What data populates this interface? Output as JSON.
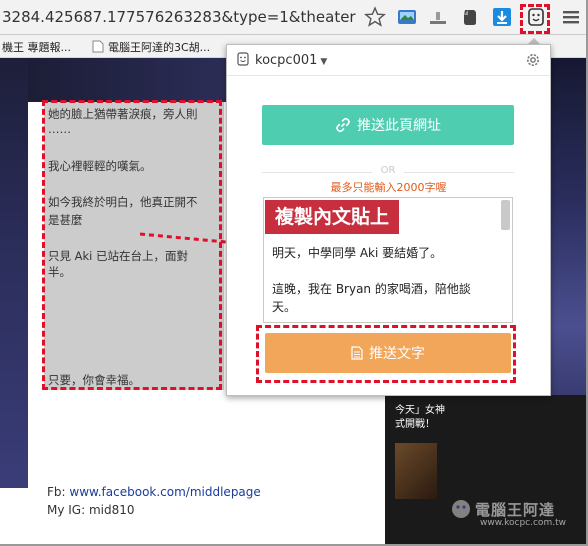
{
  "browser": {
    "url": "3284.425687.177576263283&type=1&theater",
    "bookmarks": [
      "機王 專題報...",
      "電腦王阿達的3C胡..."
    ]
  },
  "article": {
    "lines": [
      "她的臉上猶帶著淚痕，旁人則",
      "……",
      "",
      "我心裡輕輕的嘆氣。",
      "",
      "如今我終於明白，他真正開不",
      "是甚麼",
      "",
      "只見 Aki 已站在台上，面對",
      "半。",
      "",
      "",
      "",
      "",
      "只要，你會幸福。"
    ],
    "fb_label": "Fb: ",
    "fb_link": "www.facebook.com/middlepage",
    "ig": "My IG: mid810"
  },
  "popup": {
    "account": "kocpc001",
    "push_url_label": "推送此頁網址",
    "or_label": "OR",
    "limit_note": "最多只能輸入2000字喔",
    "textarea_lines": [
      "明天，中學同學 Aki 要結婚了。",
      "",
      "這晚，我在 Bryan 的家喝酒，陪他談",
      "天。"
    ],
    "push_text_label": "推送文字"
  },
  "annotation": {
    "callout": "複製內文貼上"
  },
  "right_panel": {
    "lines": [
      "今天」女神",
      "式開戰！"
    ]
  },
  "watermark": {
    "text": "電腦王阿達",
    "url": "www.kocpc.com.tw"
  },
  "colors": {
    "push_url_button": "#4ecdb1",
    "push_text_button": "#f2a65a",
    "limit_note": "#e05a1a",
    "highlight": "#e0102a",
    "callout_bg": "#c41e2e"
  }
}
